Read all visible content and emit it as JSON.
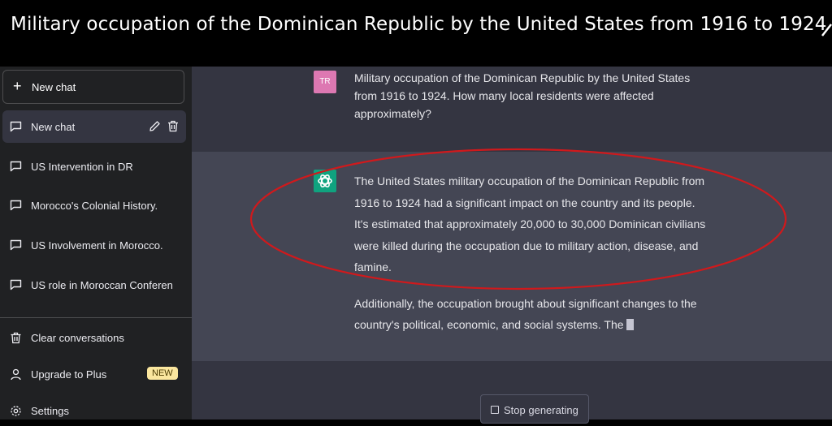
{
  "video": {
    "title": "Military occupation of the Dominican Republic by the United States from 1916 to 1924"
  },
  "sidebar": {
    "new_chat_label": "New chat",
    "chats": [
      {
        "label": "New chat"
      },
      {
        "label": "US Intervention in DR"
      },
      {
        "label": "Morocco's Colonial History."
      },
      {
        "label": "US Involvement in Morocco."
      },
      {
        "label": "US role in Moroccan Conferen"
      }
    ],
    "bottom": {
      "clear_label": "Clear conversations",
      "upgrade_label": "Upgrade to Plus",
      "upgrade_badge": "NEW",
      "settings_label": "Settings"
    }
  },
  "conversation": {
    "user_avatar_initials": "TR",
    "user_message": "Military occupation of the Dominican Republic by the United States from 1916 to 1924. How many local residents were affected approximately?",
    "assistant_paragraph_1": "The United States military occupation of the Dominican Republic from 1916 to 1924 had a significant impact on the country and its people. It's estimated that approximately 20,000 to 30,000 Dominican civilians were killed during the occupation due to military action, disease, and famine.",
    "assistant_paragraph_2": "Additionally, the occupation brought about significant changes to the country's political, economic, and social systems. The"
  },
  "controls": {
    "stop_generating_label": "Stop generating"
  },
  "colors": {
    "sidebar_bg": "#202123",
    "main_bg": "#343541",
    "assistant_bg": "#444654",
    "annotation_red": "#d0191c",
    "gpt_green": "#10a37f",
    "user_avatar_pink": "#dd78b2"
  }
}
